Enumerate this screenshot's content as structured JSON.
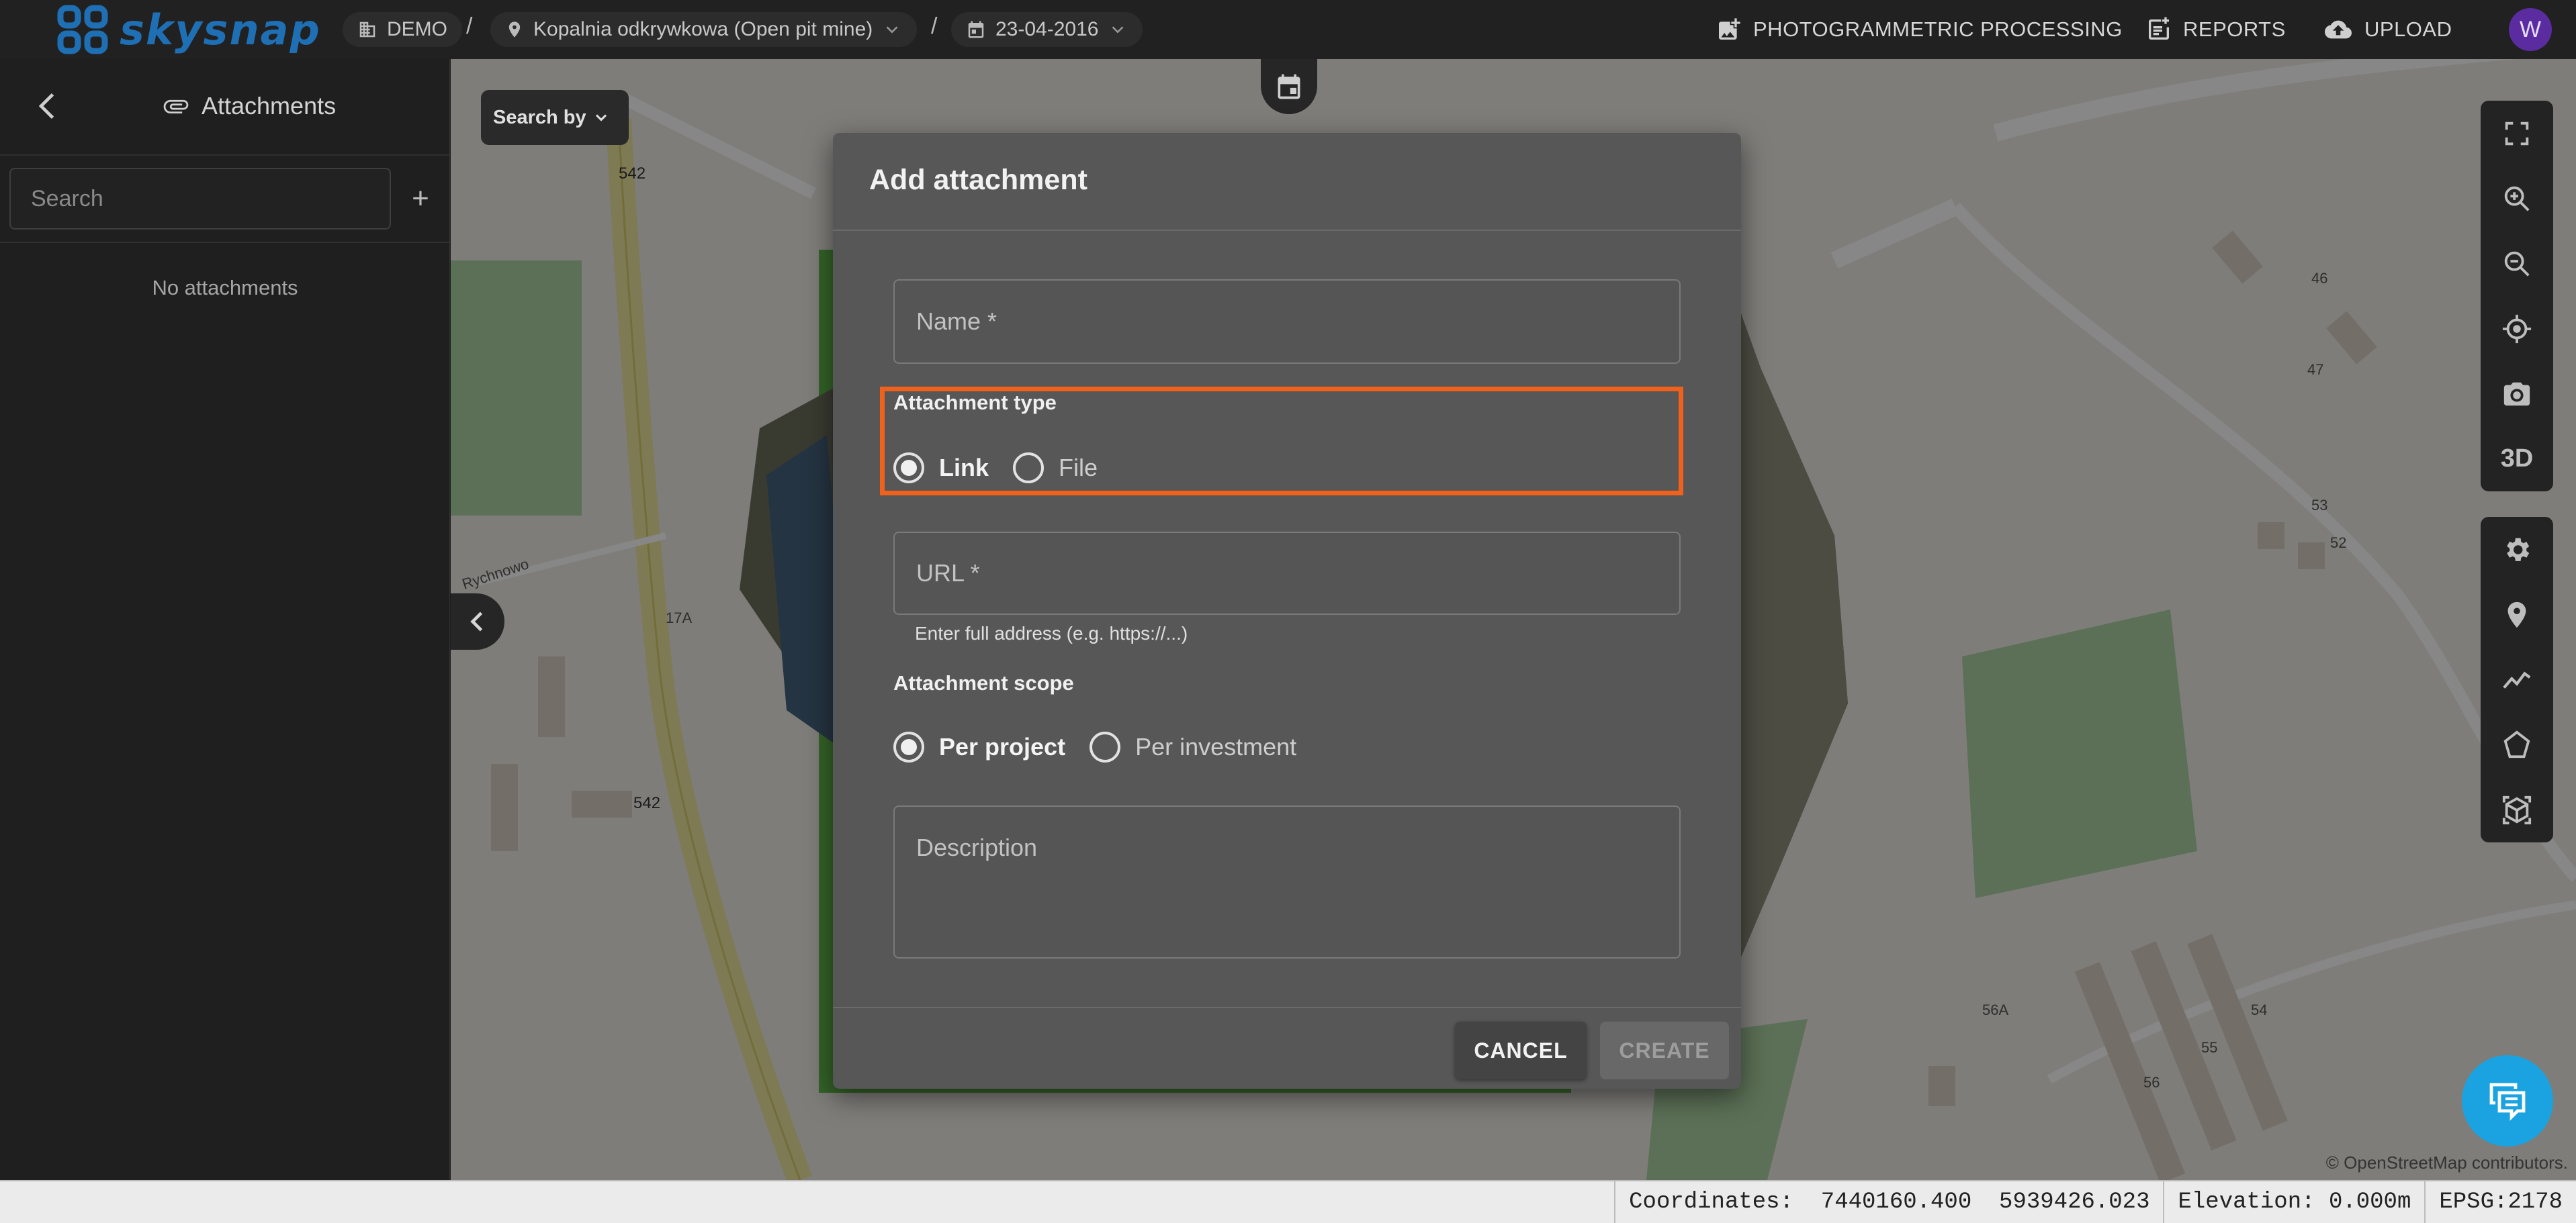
{
  "app": {
    "brand": "skysnap"
  },
  "breadcrumb": {
    "org": "DEMO",
    "project": "Kopalnia odkrywkowa (Open pit mine)",
    "date": "23-04-2016",
    "separator": "/"
  },
  "topnav": {
    "processing": "PHOTOGRAMMETRIC PROCESSING",
    "reports": "REPORTS",
    "upload": "UPLOAD",
    "avatar_initial": "W"
  },
  "sidebar": {
    "title": "Attachments",
    "search_placeholder": "Search",
    "add": "+",
    "empty": "No attachments"
  },
  "map": {
    "search_by": "Search by",
    "tools_top": [
      "fullscreen-icon",
      "zoom-in-icon",
      "zoom-out-icon",
      "locate-icon",
      "camera-icon",
      "3D"
    ],
    "tools_bottom": [
      "settings-icon",
      "marker-icon",
      "polyline-icon",
      "polygon-icon",
      "cube-icon"
    ],
    "road_labels": [
      "542",
      "542",
      "Rychnowo",
      "17A",
      "46",
      "47",
      "53",
      "52",
      "56A",
      "55",
      "56",
      "54"
    ],
    "attribution_prefix": "© OpenStreetMap",
    "attribution_suffix": " contributors."
  },
  "dialog": {
    "title": "Add attachment",
    "name_placeholder": "Name *",
    "type_label": "Attachment type",
    "type_options": [
      "Link",
      "File"
    ],
    "type_selected": "Link",
    "url_placeholder": "URL *",
    "url_hint": "Enter full address (e.g. https://...)",
    "scope_label": "Attachment scope",
    "scope_options": [
      "Per project",
      "Per investment"
    ],
    "scope_selected": "Per project",
    "description_placeholder": "Description",
    "cancel": "CANCEL",
    "create": "CREATE",
    "highlight_color": "#f0621c"
  },
  "status": {
    "coordinates_label": "Coordinates:",
    "x": "7440160.400",
    "y": "5939426.023",
    "elevation_label": "Elevation:",
    "elevation": "0.000m",
    "epsg": "EPSG:2178"
  }
}
